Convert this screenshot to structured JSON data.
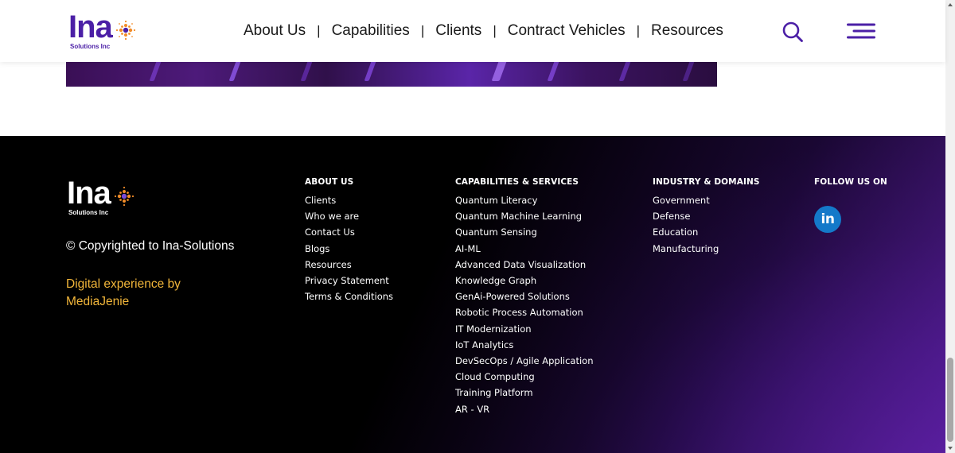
{
  "logo": {
    "word": "Ina",
    "sub": "Solutions Inc"
  },
  "nav": {
    "items": [
      {
        "label": "About Us"
      },
      {
        "label": "Capabilities"
      },
      {
        "label": "Clients"
      },
      {
        "label": "Contract Vehicles"
      },
      {
        "label": "Resources"
      }
    ],
    "separator": "|",
    "search_icon": "search-icon",
    "menu_icon": "hamburger-menu-icon"
  },
  "footer": {
    "copyright": "© Copyrighted to Ina-Solutions",
    "credit": "Digital experience by MediaJenie",
    "about": {
      "title": "ABOUT US",
      "links": [
        "Clients",
        "Who we are",
        "Contact Us",
        "Blogs",
        "Resources",
        "Privacy Statement",
        "Terms & Conditions"
      ]
    },
    "capabilities": {
      "title": "CAPABILITIES & SERVICES",
      "links": [
        "Quantum Literacy",
        "Quantum Machine Learning",
        "Quantum Sensing",
        "AI-ML",
        "Advanced Data Visualization",
        "Knowledge Graph",
        "GenAi-Powered Solutions",
        "Robotic Process Automation",
        "IT Modernization",
        "IoT Analytics",
        "DevSecOps / Agile Application",
        "Cloud Computing",
        "Training Platform",
        "AR - VR"
      ]
    },
    "industry": {
      "title": "INDUSTRY & DOMAINS",
      "links": [
        "Government",
        "Defense",
        "Education",
        "Manufacturing"
      ]
    },
    "follow": {
      "title": "FOLLOW US ON",
      "linkedin_glyph": "in",
      "icon": "linkedin-icon"
    }
  },
  "colors": {
    "brand_purple": "#4b1fa6",
    "accent_orange": "#f28c28",
    "credit_gold": "#f2b63a",
    "linkedin_blue": "#1479c9",
    "footer_bg": "#050308"
  }
}
